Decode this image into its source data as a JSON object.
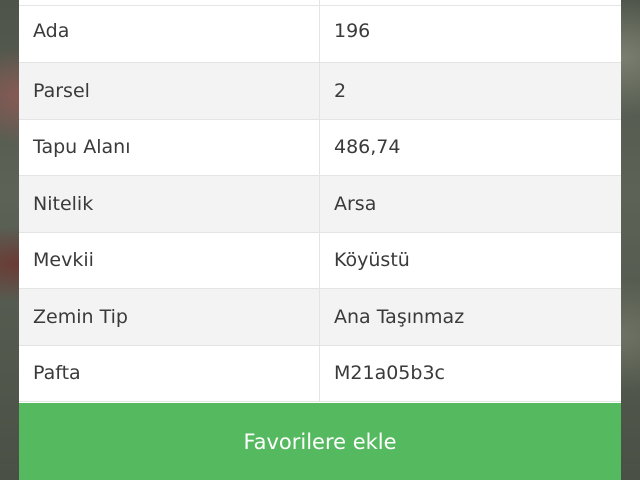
{
  "details": {
    "rows": [
      {
        "label": "Ada",
        "value": "196"
      },
      {
        "label": "Parsel",
        "value": "2"
      },
      {
        "label": "Tapu Alanı",
        "value": "486,74"
      },
      {
        "label": "Nitelik",
        "value": "Arsa"
      },
      {
        "label": "Mevkii",
        "value": "Köyüstü"
      },
      {
        "label": "Zemin Tip",
        "value": "Ana Taşınmaz"
      },
      {
        "label": "Pafta",
        "value": "M21a05b3c"
      }
    ]
  },
  "actions": {
    "favorite_label": "Favorilere ekle"
  },
  "colors": {
    "button_green": "#55b95f",
    "row_shade": "#f3f3f3"
  }
}
